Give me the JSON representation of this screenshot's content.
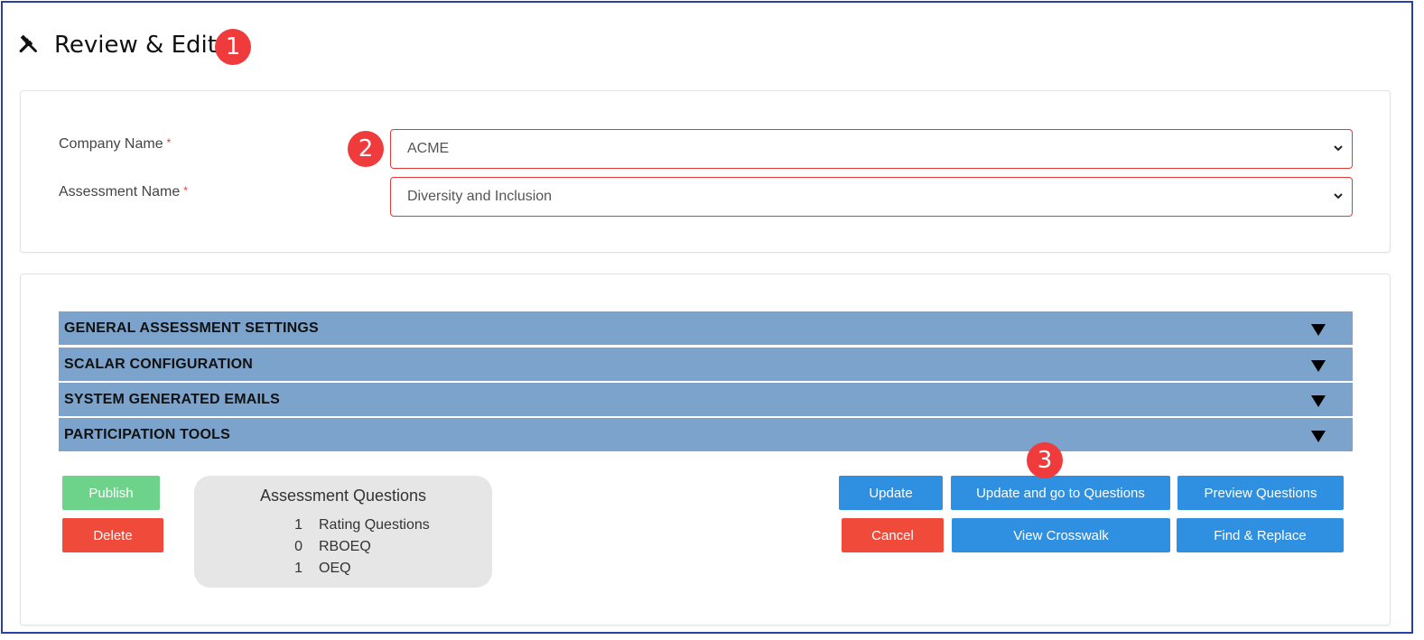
{
  "header": {
    "title": "Review & Edit",
    "icon": "tools-icon"
  },
  "callouts": [
    "1",
    "2",
    "3"
  ],
  "form": {
    "company": {
      "label": "Company Name",
      "required_mark": "*",
      "value": "ACME"
    },
    "assessment": {
      "label": "Assessment Name",
      "required_mark": "*",
      "value": "Diversity and Inclusion"
    }
  },
  "sections": [
    "GENERAL ASSESSMENT SETTINGS",
    "SCALAR CONFIGURATION",
    "SYSTEM GENERATED EMAILS",
    "PARTICIPATION TOOLS"
  ],
  "actions_left": {
    "publish": "Publish",
    "delete": "Delete"
  },
  "summary": {
    "title": "Assessment Questions",
    "rows": [
      {
        "count": "1",
        "label": "Rating Questions"
      },
      {
        "count": "0",
        "label": "RBOEQ"
      },
      {
        "count": "1",
        "label": "OEQ"
      }
    ]
  },
  "actions_right": {
    "update": "Update",
    "update_go": "Update and go to Questions",
    "preview": "Preview Questions",
    "cancel": "Cancel",
    "crosswalk": "View Crosswalk",
    "find_replace": "Find & Replace"
  },
  "colors": {
    "border_frame": "#2b3fa8",
    "badge": "#ef3b3b",
    "accordion": "#7ba3cc",
    "primary": "#2f8fe0",
    "danger": "#f04a3a",
    "success": "#6dd28a"
  }
}
